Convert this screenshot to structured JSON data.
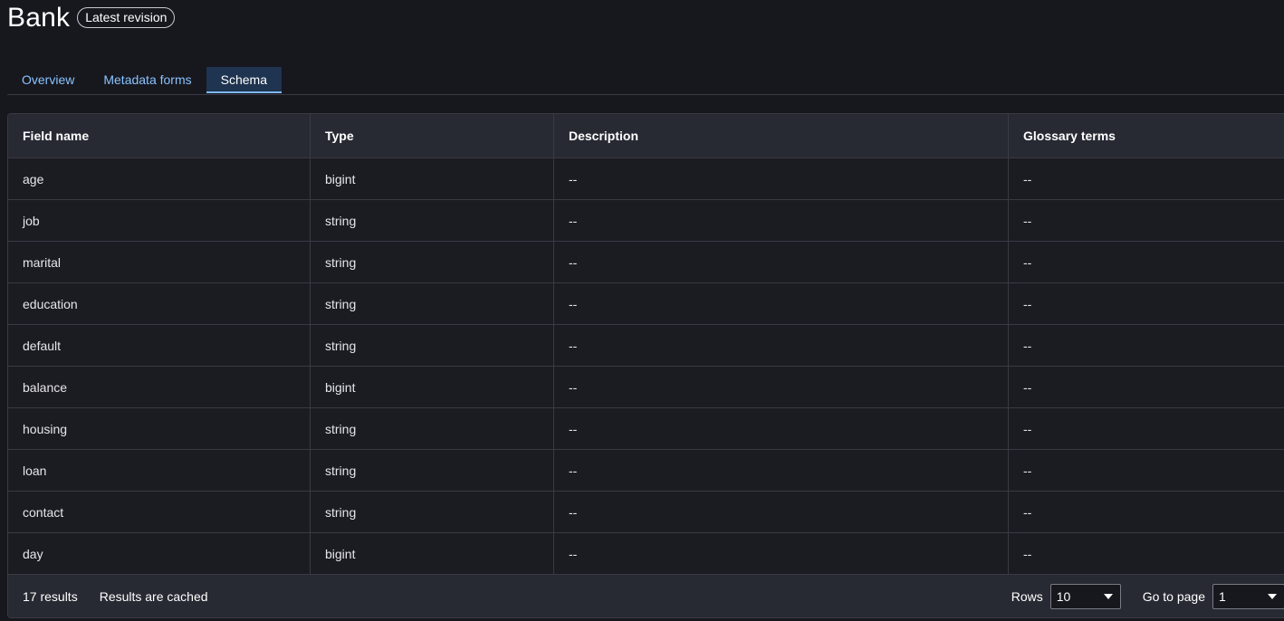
{
  "header": {
    "title": "Bank",
    "badge": "Latest revision"
  },
  "tabs": [
    {
      "label": "Overview",
      "active": false
    },
    {
      "label": "Metadata forms",
      "active": false
    },
    {
      "label": "Schema",
      "active": true
    }
  ],
  "table": {
    "columns": [
      "Field name",
      "Type",
      "Description",
      "Glossary terms"
    ],
    "rows": [
      [
        "age",
        "bigint",
        "--",
        "--"
      ],
      [
        "job",
        "string",
        "--",
        "--"
      ],
      [
        "marital",
        "string",
        "--",
        "--"
      ],
      [
        "education",
        "string",
        "--",
        "--"
      ],
      [
        "default",
        "string",
        "--",
        "--"
      ],
      [
        "balance",
        "bigint",
        "--",
        "--"
      ],
      [
        "housing",
        "string",
        "--",
        "--"
      ],
      [
        "loan",
        "string",
        "--",
        "--"
      ],
      [
        "contact",
        "string",
        "--",
        "--"
      ],
      [
        "day",
        "bigint",
        "--",
        "--"
      ]
    ]
  },
  "footer": {
    "results": "17 results",
    "cached": "Results are cached",
    "rows_label": "Rows",
    "rows_value": "10",
    "page_label": "Go to page",
    "page_value": "1"
  },
  "colors": {
    "background": "#17171e",
    "header_bg": "#272a33",
    "link": "#89c4ff",
    "active_tab_bg": "#1e3450"
  },
  "icons": [
    "chevron-down-icon"
  ]
}
